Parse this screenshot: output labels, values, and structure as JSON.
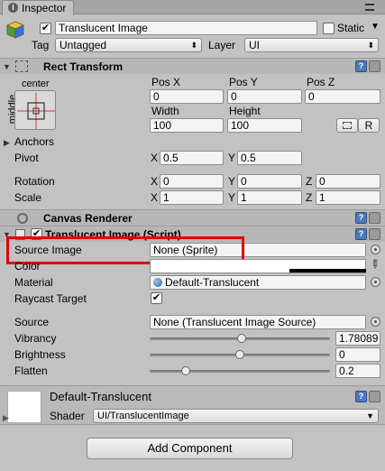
{
  "tab": {
    "title": "Inspector",
    "icon": "info-icon"
  },
  "object": {
    "name": "Translucent Image",
    "active": true,
    "static_label": "Static",
    "static_checked": false,
    "tag_label": "Tag",
    "tag_value": "Untagged",
    "layer_label": "Layer",
    "layer_value": "UI"
  },
  "rect_transform": {
    "title": "Rect Transform",
    "anchor_h": "center",
    "anchor_v": "middle",
    "pos_x_label": "Pos X",
    "pos_y_label": "Pos Y",
    "pos_z_label": "Pos Z",
    "pos_x": "0",
    "pos_y": "0",
    "pos_z": "0",
    "width_label": "Width",
    "height_label": "Height",
    "width": "100",
    "height": "100",
    "raw_button": "R",
    "anchors_label": "Anchors",
    "pivot_label": "Pivot",
    "pivot_x": "0.5",
    "pivot_y": "0.5",
    "rotation_label": "Rotation",
    "rotation": {
      "x": "0",
      "y": "0",
      "z": "0"
    },
    "scale_label": "Scale",
    "scale": {
      "x": "1",
      "y": "1",
      "z": "1"
    },
    "axis": {
      "x": "X",
      "y": "Y",
      "z": "Z"
    }
  },
  "canvas_renderer": {
    "title": "Canvas Renderer"
  },
  "translucent_image": {
    "title": "Translucent Image (Script)",
    "source_image_label": "Source Image",
    "source_image_value": "None (Sprite)",
    "color_label": "Color",
    "material_label": "Material",
    "material_value": "Default-Translucent",
    "raycast_label": "Raycast Target",
    "raycast_checked": true,
    "source_label": "Source",
    "source_value": "None (Translucent Image Source)",
    "vibrancy_label": "Vibrancy",
    "vibrancy_value": "1.78089",
    "vibrancy_fraction": 0.51,
    "brightness_label": "Brightness",
    "brightness_value": "0",
    "brightness_fraction": 0.5,
    "flatten_label": "Flatten",
    "flatten_value": "0.2",
    "flatten_fraction": 0.2
  },
  "material_panel": {
    "name": "Default-Translucent",
    "shader_label": "Shader",
    "shader_value": "UI/TranslucentImage"
  },
  "add_component": "Add Component",
  "colors": {
    "highlight": "#e00000",
    "help": "#4d79b8"
  }
}
